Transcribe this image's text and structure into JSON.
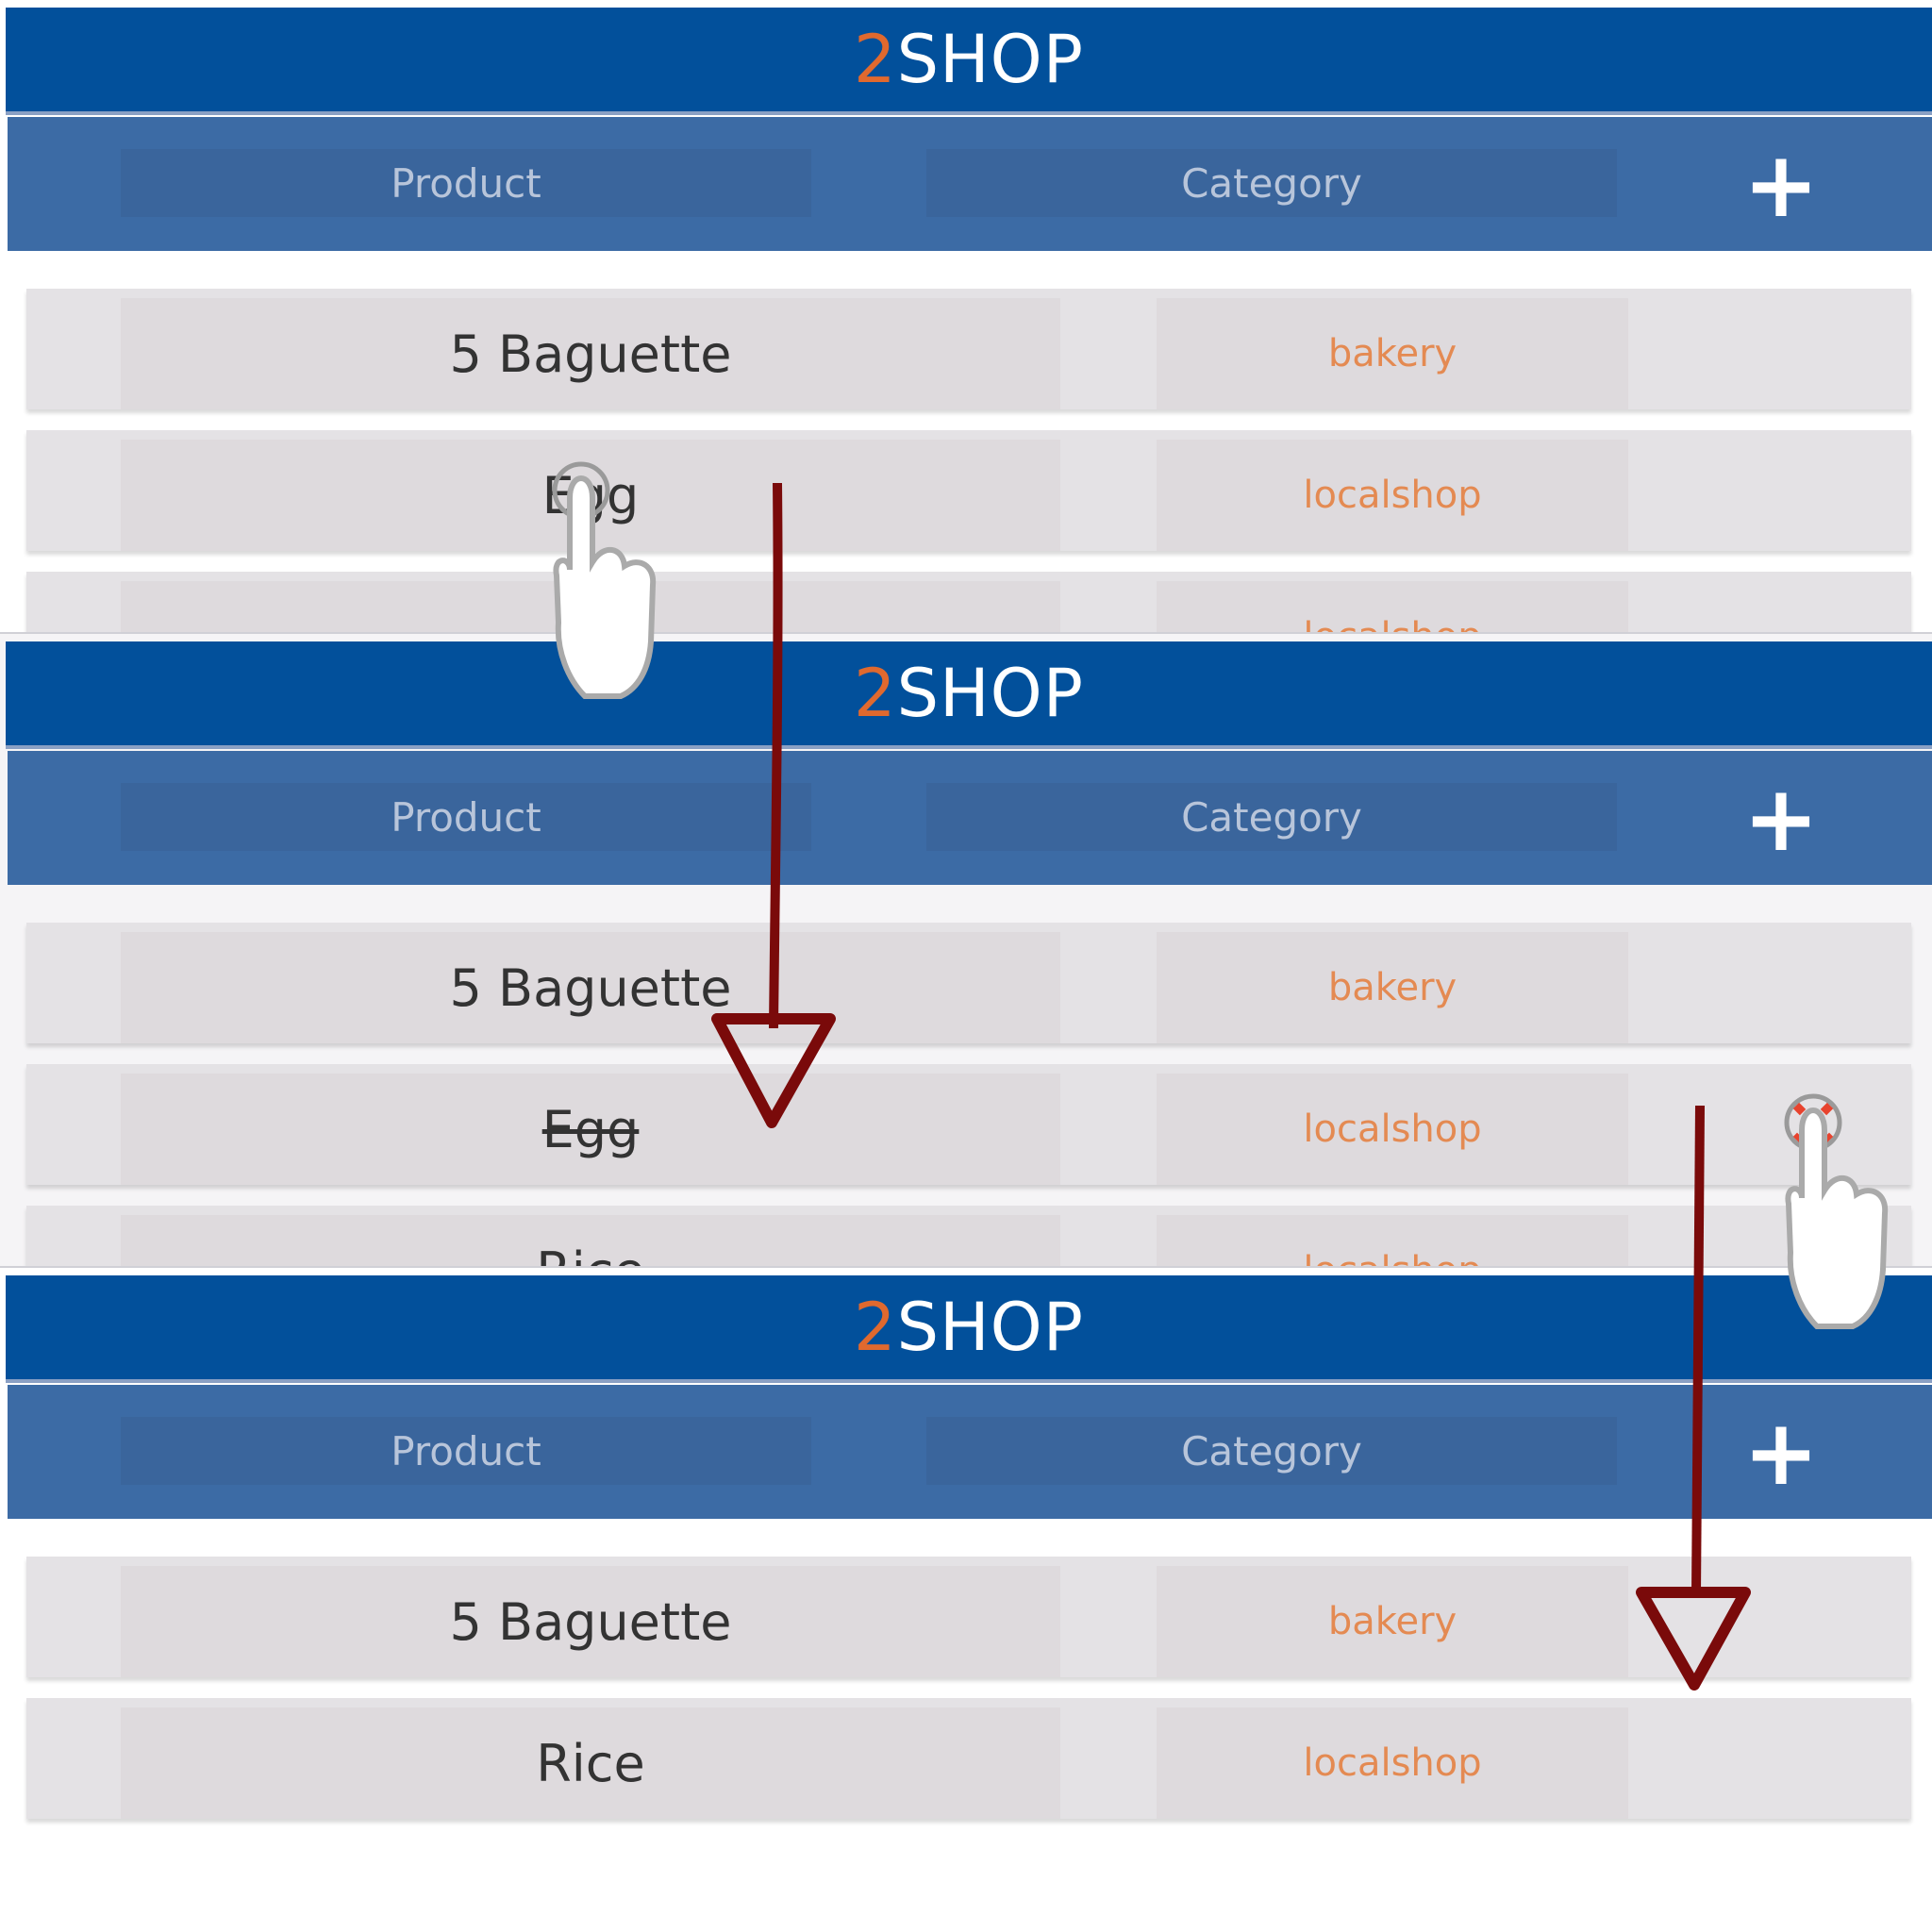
{
  "app": {
    "title_prefix": "2",
    "title_rest": "SHOP"
  },
  "header": {
    "product_label": "Product",
    "category_label": "Category",
    "add_label": "+"
  },
  "frames": [
    {
      "rows": [
        {
          "product": "5 Baguette",
          "category": "bakery",
          "struck": false
        },
        {
          "product": "Egg",
          "category": "localshop",
          "struck": false
        },
        {
          "product": "",
          "category": "localshop",
          "struck": false
        }
      ]
    },
    {
      "rows": [
        {
          "product": "5 Baguette",
          "category": "bakery",
          "struck": false
        },
        {
          "product": "Egg",
          "category": "localshop",
          "struck": true
        },
        {
          "product": "Rice",
          "category": "localshop",
          "struck": false
        }
      ]
    },
    {
      "rows": [
        {
          "product": "5 Baguette",
          "category": "bakery",
          "struck": false
        },
        {
          "product": "Rice",
          "category": "localshop",
          "struck": false
        }
      ]
    }
  ],
  "colors": {
    "title_bar": "#02509b",
    "header_bar": "#3c6ba5",
    "accent": "#e0692e",
    "arrow": "#7a0a0a",
    "delete": "#e8432e"
  },
  "icons": [
    "tap-hand-icon",
    "arrow-down-icon",
    "delete-x-icon",
    "plus-icon"
  ]
}
